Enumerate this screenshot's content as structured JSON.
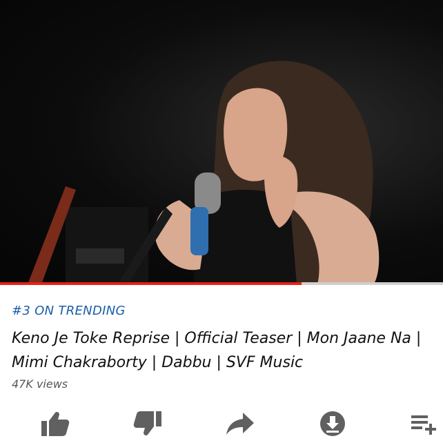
{
  "player": {
    "progress_fraction": 0.68,
    "progress_color": "#e62117"
  },
  "video_info": {
    "trending_label": "#3 ON TRENDING",
    "title": "Keno Je Toke Reprise | Official Teaser | Mon Jaane Na | Mimi Chakraborty | Dabbu | SVF Music",
    "views": "47K views"
  },
  "actions": [
    {
      "name": "like-button",
      "icon": "thumbs-up-icon"
    },
    {
      "name": "dislike-button",
      "icon": "thumbs-down-icon"
    },
    {
      "name": "share-button",
      "icon": "share-arrow-icon"
    },
    {
      "name": "download-button",
      "icon": "download-icon"
    },
    {
      "name": "add-to-playlist-button",
      "icon": "playlist-add-icon"
    }
  ],
  "colors": {
    "trending": "#1a5fa8",
    "icon": "#606060"
  }
}
